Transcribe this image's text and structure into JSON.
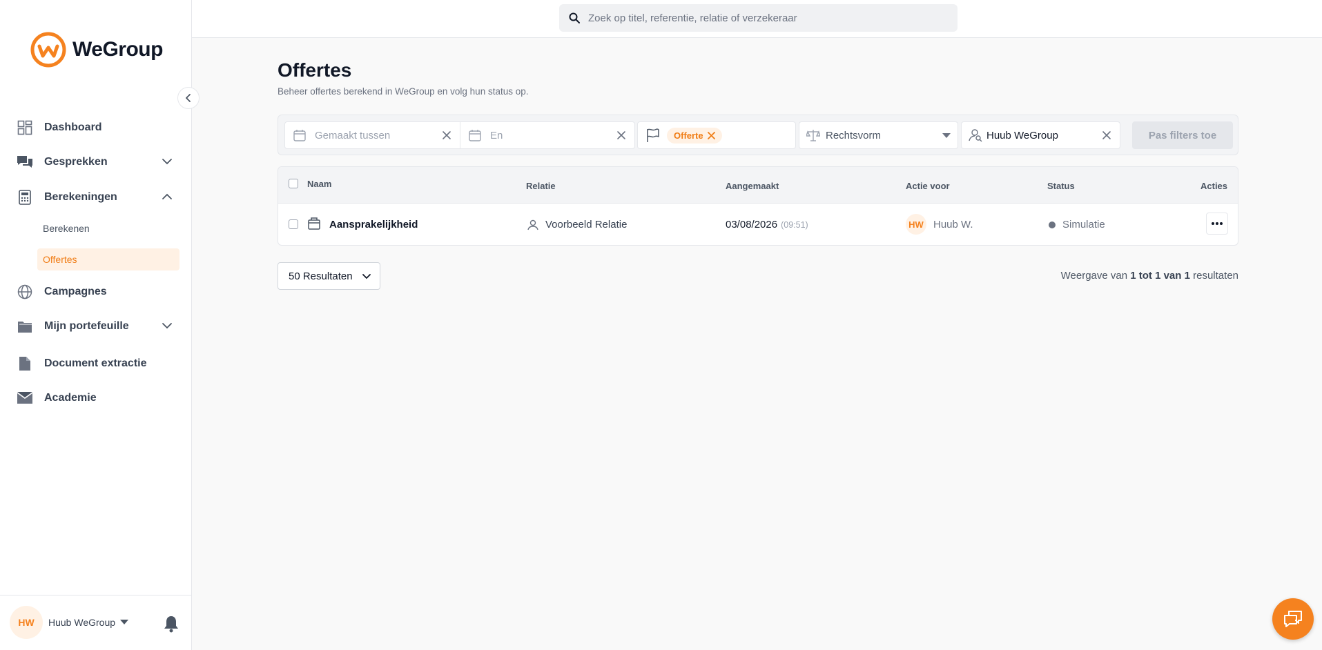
{
  "brand": {
    "name": "WeGroup",
    "accent": "#f5821f"
  },
  "search": {
    "placeholder": "Zoek op titel, referentie, relatie of verzekeraar"
  },
  "sidebar": {
    "items": [
      {
        "label": "Dashboard",
        "icon": "dashboard-icon"
      },
      {
        "label": "Gesprekken",
        "icon": "chat-icon",
        "expandable": true,
        "expanded": false
      },
      {
        "label": "Berekeningen",
        "icon": "calculator-icon",
        "expandable": true,
        "expanded": true,
        "children": [
          {
            "label": "Berekenen"
          },
          {
            "label": "Offertes",
            "active": true
          }
        ]
      },
      {
        "label": "Campagnes",
        "icon": "globe-icon"
      },
      {
        "label": "Mijn portefeuille",
        "icon": "folder-icon",
        "expandable": true,
        "expanded": false
      },
      {
        "label": "Document extractie",
        "icon": "document-icon"
      },
      {
        "label": "Academie",
        "icon": "academy-icon"
      }
    ]
  },
  "user": {
    "initials": "HW",
    "name": "Huub WeGroup"
  },
  "page": {
    "title": "Offertes",
    "subtitle": "Beheer offertes berekend in WeGroup en volg hun status op."
  },
  "filters": {
    "created_between_placeholder": "Gemaakt tussen",
    "and_placeholder": "En",
    "status_tag": "Offerte",
    "legal_form_placeholder": "Rechtsvorm",
    "assignee": "Huub WeGroup",
    "apply_label": "Pas filters toe"
  },
  "table": {
    "columns": [
      "Naam",
      "Relatie",
      "Aangemaakt",
      "Actie voor",
      "Status",
      "Acties"
    ],
    "rows": [
      {
        "name": "Aansprakelijkheid",
        "relation": "Voorbeeld Relatie",
        "created_date": "03/08/2026",
        "created_time": "(09:51)",
        "assignee_initials": "HW",
        "assignee": "Huub W.",
        "status": "Simulatie"
      }
    ]
  },
  "pagination": {
    "page_size_label": "50 Resultaten",
    "summary_prefix": "Weergave van",
    "summary_range": "1 tot 1 van 1",
    "summary_suffix": "resultaten"
  }
}
